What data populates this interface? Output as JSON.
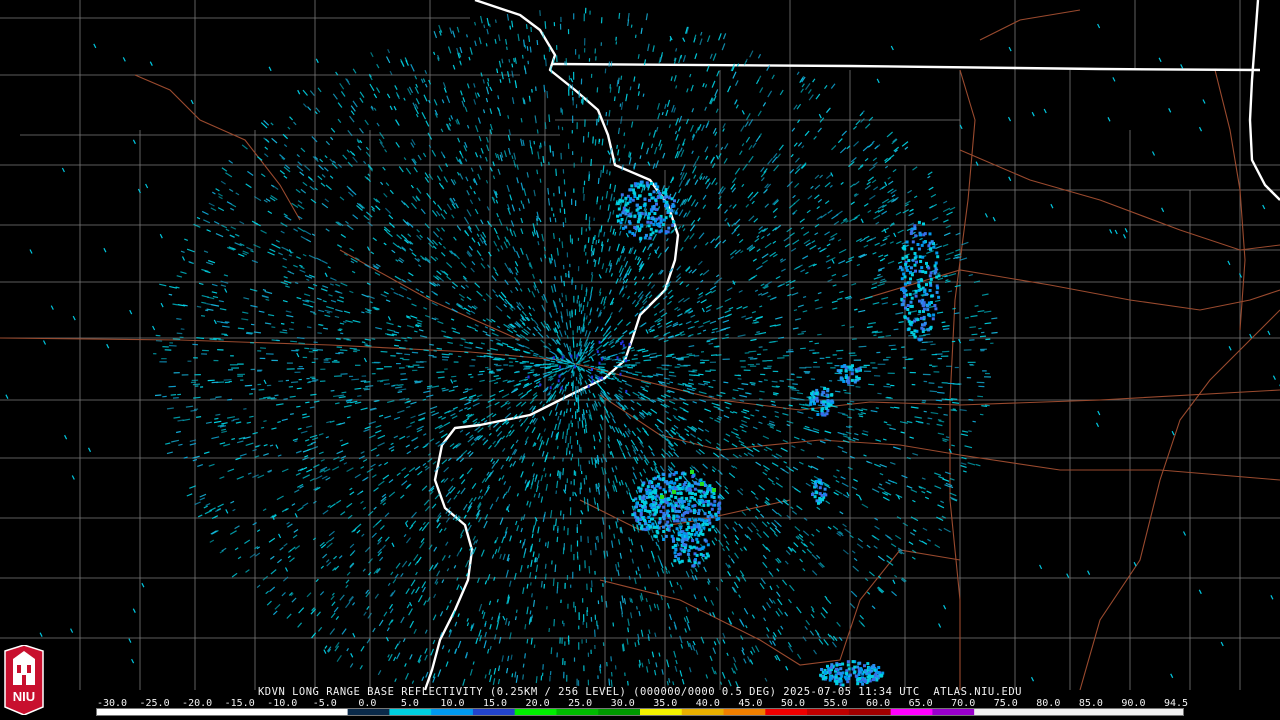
{
  "caption": "KDVN LONG RANGE BASE REFLECTIVITY (0.25KM / 256 LEVEL) (000000/0000 0.5 DEG) 2025-07-05 11:34 UTC  ATLAS.NIU.EDU",
  "radar_site": "KDVN",
  "product": "LONG RANGE BASE REFLECTIVITY",
  "resolution": "0.25KM / 256 LEVEL",
  "elevation": "0.5 DEG",
  "datetime": "2025-07-05 11:34 UTC",
  "source": "ATLAS.NIU.EDU",
  "logo_text": "NIU",
  "scale": {
    "labels": [
      "-30.0",
      "-25.0",
      "-20.0",
      "-15.0",
      "-10.0",
      "-5.0",
      "0.0",
      "5.0",
      "10.0",
      "15.0",
      "20.0",
      "25.0",
      "30.0",
      "35.0",
      "40.0",
      "45.0",
      "50.0",
      "55.0",
      "60.0",
      "65.0",
      "70.0",
      "75.0",
      "80.0",
      "85.0",
      "90.0",
      "94.5"
    ],
    "colors": [
      "#000000",
      "#000000",
      "#000000",
      "#000000",
      "#000000",
      "#000000",
      "#0a2a4a",
      "#00cfe0",
      "#0099ee",
      "#2244cc",
      "#00ee00",
      "#00bb00",
      "#009900",
      "#f2f200",
      "#e8b000",
      "#f08000",
      "#ee0000",
      "#c00000",
      "#a00000",
      "#ff00ff",
      "#9900cc",
      "#f0f0f0",
      "#f0f0f0",
      "#f0f0f0",
      "#f0f0f0",
      "#f0f0f0"
    ]
  }
}
